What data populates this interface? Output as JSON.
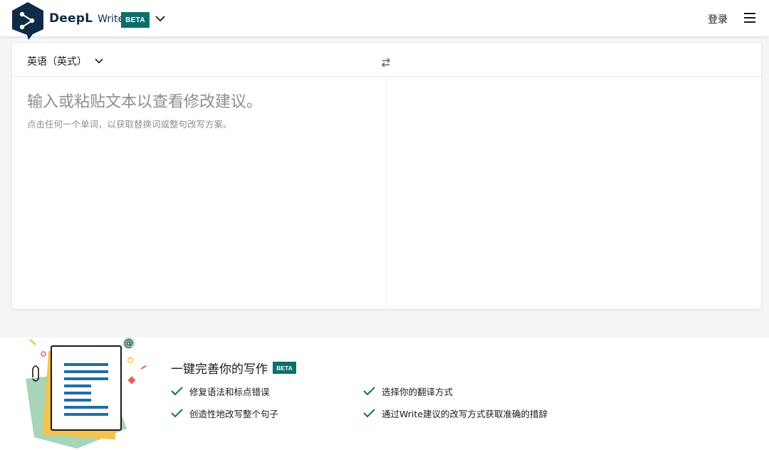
{
  "header": {
    "brand_name": "DeepL",
    "brand_sub": "Write",
    "beta_label": "BETA",
    "login_label": "登录",
    "icons": {
      "logo": "deepl-logo-icon",
      "dropdown": "chevron-down-icon",
      "menu": "hamburger-menu-icon"
    },
    "brand_color": "#0f2b46",
    "beta_color": "#0b6e6a"
  },
  "editor": {
    "language_label": "英语（英式）",
    "placeholder": "输入或粘贴文本以查看修改建议。",
    "hint": "点击任何一个单词，以获取替换词或整句改写方案。",
    "swap_icon": "swap-arrows-icon"
  },
  "promo": {
    "title": "一键完善你的写作",
    "beta_label": "BETA",
    "check_color": "#0b6e6a",
    "features": [
      "修复语法和标点错误",
      "选择你的翻译方式",
      "创造性地改写整个句子",
      "通过Write建议的改写方式获取准确的措辞"
    ]
  }
}
